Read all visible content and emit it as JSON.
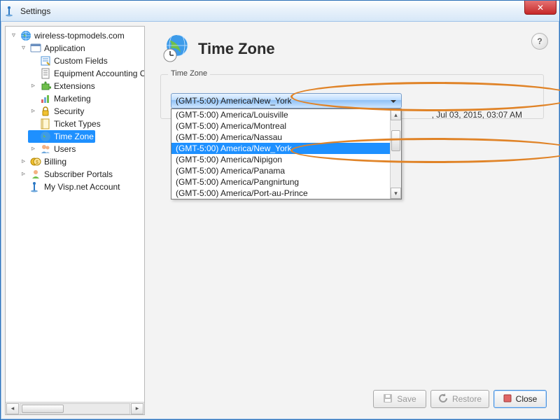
{
  "window": {
    "title": "Settings"
  },
  "tree": {
    "root": "wireless-topmodels.com",
    "application": "Application",
    "custom_fields": "Custom Fields",
    "equip": "Equipment Accounting Controls",
    "extensions": "Extensions",
    "marketing": "Marketing",
    "security": "Security",
    "ticket_types": "Ticket Types",
    "time_zone": "Time Zone",
    "users": "Users",
    "billing": "Billing",
    "portals": "Subscriber Portals",
    "my_account": "My Visp.net Account"
  },
  "page": {
    "title": "Time Zone",
    "section_label": "Time Zone",
    "selected_tz": "(GMT-5:00) America/New_York",
    "timestamp": ", Jul 03, 2015, 03:07 AM"
  },
  "tz_options": [
    "(GMT-5:00) America/Louisville",
    "(GMT-5:00) America/Montreal",
    "(GMT-5:00) America/Nassau",
    "(GMT-5:00) America/New_York",
    "(GMT-5:00) America/Nipigon",
    "(GMT-5:00) America/Panama",
    "(GMT-5:00) America/Pangnirtung",
    "(GMT-5:00) America/Port-au-Prince"
  ],
  "buttons": {
    "save": "Save",
    "restore": "Restore",
    "close": "Close"
  },
  "help": "?"
}
